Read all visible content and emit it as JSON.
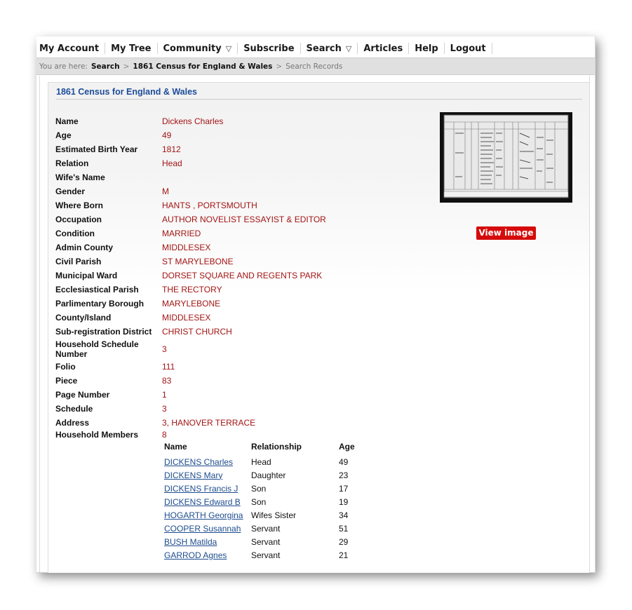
{
  "nav": {
    "items": [
      {
        "label": "My Account",
        "dropdown": false
      },
      {
        "label": "My Tree",
        "dropdown": false
      },
      {
        "label": "Community",
        "dropdown": true
      },
      {
        "label": "Subscribe",
        "dropdown": false
      },
      {
        "label": "Search",
        "dropdown": true
      },
      {
        "label": "Articles",
        "dropdown": false
      },
      {
        "label": "Help",
        "dropdown": false
      },
      {
        "label": "Logout",
        "dropdown": false
      }
    ],
    "dropdown_glyph": "▽"
  },
  "breadcrumb": {
    "prefix": "You are here:",
    "items": [
      "Search",
      "1861 Census for England & Wales",
      "Search Records"
    ],
    "separator": ">"
  },
  "record": {
    "title": "1861 Census for England & Wales",
    "fields": [
      {
        "label": "Name",
        "value": "Dickens Charles"
      },
      {
        "label": "Age",
        "value": "49"
      },
      {
        "label": "Estimated Birth Year",
        "value": "1812"
      },
      {
        "label": "Relation",
        "value": "Head"
      },
      {
        "label": "Wife's Name",
        "value": ""
      },
      {
        "label": "Gender",
        "value": "M"
      },
      {
        "label": "Where Born",
        "value": "HANTS , PORTSMOUTH"
      },
      {
        "label": "Occupation",
        "value": "AUTHOR NOVELIST ESSAYIST & EDITOR"
      },
      {
        "label": "Condition",
        "value": "MARRIED"
      },
      {
        "label": "Admin County",
        "value": "MIDDLESEX"
      },
      {
        "label": "Civil Parish",
        "value": "ST MARYLEBONE"
      },
      {
        "label": "Municipal Ward",
        "value": "DORSET SQUARE AND REGENTS PARK"
      },
      {
        "label": "Ecclesiastical Parish",
        "value": "THE RECTORY"
      },
      {
        "label": "Parlimentary Borough",
        "value": "MARYLEBONE"
      },
      {
        "label": "County/Island",
        "value": "MIDDLESEX"
      },
      {
        "label": "Sub-registration District",
        "value": "CHRIST CHURCH"
      },
      {
        "label": "Household Schedule Number",
        "value": "3"
      },
      {
        "label": "Folio",
        "value": "111"
      },
      {
        "label": "Piece",
        "value": "83"
      },
      {
        "label": "Page Number",
        "value": "1"
      },
      {
        "label": "Schedule",
        "value": "3"
      },
      {
        "label": "Address",
        "value": "3, HANOVER TERRACE"
      },
      {
        "label": "Household Members",
        "value": "8"
      }
    ],
    "view_image_label": "View image"
  },
  "household": {
    "headers": [
      "Name",
      "Relationship",
      "Age"
    ],
    "members": [
      {
        "name": "DICKENS Charles",
        "relationship": "Head",
        "age": "49"
      },
      {
        "name": "DICKENS Mary",
        "relationship": "Daughter",
        "age": "23"
      },
      {
        "name": "DICKENS Francis J",
        "relationship": "Son",
        "age": "17"
      },
      {
        "name": "DICKENS Edward B",
        "relationship": "Son",
        "age": "19"
      },
      {
        "name": "HOGARTH Georgina",
        "relationship": "Wifes Sister",
        "age": "34"
      },
      {
        "name": "COOPER Susannah",
        "relationship": "Servant",
        "age": "51"
      },
      {
        "name": "BUSH Matilda",
        "relationship": "Servant",
        "age": "29"
      },
      {
        "name": "GARROD Agnes",
        "relationship": "Servant",
        "age": "21"
      }
    ]
  },
  "colors": {
    "value_text": "#a31414",
    "title_blue": "#1d4c9a",
    "link_blue": "#1d4c8e",
    "button_red": "#d60b0b"
  }
}
